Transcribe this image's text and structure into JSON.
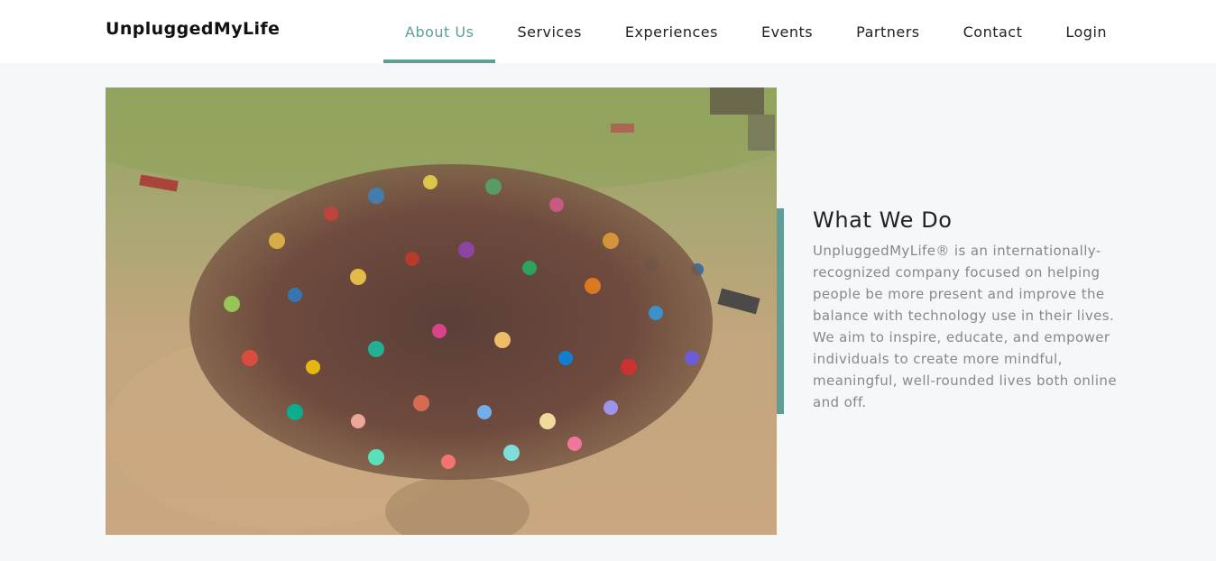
{
  "header": {
    "brand": "UnpluggedMyLife",
    "nav": [
      {
        "label": "About Us",
        "active": true
      },
      {
        "label": "Services",
        "active": false
      },
      {
        "label": "Experiences",
        "active": false
      },
      {
        "label": "Events",
        "active": false
      },
      {
        "label": "Partners",
        "active": false
      },
      {
        "label": "Contact",
        "active": false
      },
      {
        "label": "Login",
        "active": false
      }
    ],
    "accent_color": "#5f9e96"
  },
  "main": {
    "photo": {
      "icon": "group-photo"
    },
    "section": {
      "title": "What We Do",
      "body": "UnpluggedMyLife® is an internationally-recognized company focused on helping people be more present and improve the balance with technology use in their lives. We aim to inspire, educate, and empower individuals to create more mindful, meaningful, well-rounded lives both online and off."
    }
  }
}
